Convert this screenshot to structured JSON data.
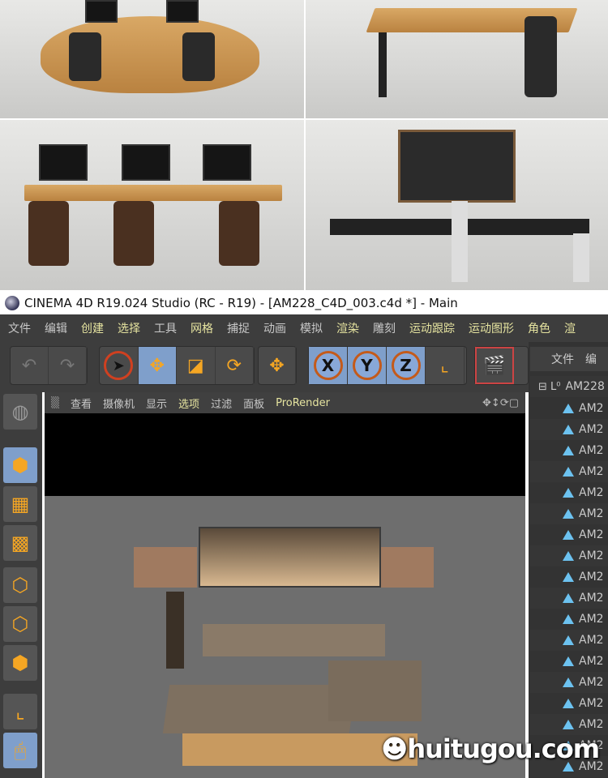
{
  "window": {
    "title": "CINEMA 4D R19.024 Studio (RC - R19) - [AM228_C4D_003.c4d *] - Main"
  },
  "menu": [
    "文件",
    "编辑",
    "创建",
    "选择",
    "工具",
    "网格",
    "捕捉",
    "动画",
    "模拟",
    "渲染",
    "雕刻",
    "运动跟踪",
    "运动图形",
    "角色",
    "渲"
  ],
  "viewport_menu": [
    "查看",
    "摄像机",
    "显示",
    "选项",
    "过滤",
    "面板",
    "ProRender"
  ],
  "object_manager": {
    "header": [
      "文件",
      "编"
    ],
    "root": "AM228",
    "children": [
      "AM2",
      "AM2",
      "AM2",
      "AM2",
      "AM2",
      "AM2",
      "AM2",
      "AM2",
      "AM2",
      "AM2",
      "AM2",
      "AM2",
      "AM2",
      "AM2",
      "AM2",
      "AM2",
      "AM2",
      "AM2"
    ]
  },
  "toolbar": {
    "axes": [
      "X",
      "Y",
      "Z"
    ]
  },
  "watermark": "huitugou.com"
}
